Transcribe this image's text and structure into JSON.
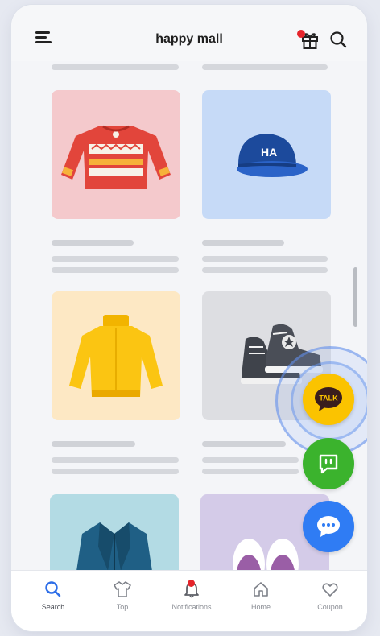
{
  "app": {
    "title": "happy mall"
  },
  "header": {
    "menu_icon": "hamburger-menu-icon",
    "gift_icon": "gift-icon",
    "search_icon": "search-icon"
  },
  "products": [
    {
      "name": "red-sweater",
      "icon": "sweater-icon",
      "background": "#f4c9cc"
    },
    {
      "name": "blue-cap",
      "icon": "cap-icon",
      "background": "#c6daf7"
    },
    {
      "name": "yellow-turtleneck",
      "icon": "turtleneck-icon",
      "background": "#fde8c4"
    },
    {
      "name": "high-top-sneakers",
      "icon": "sneakers-icon",
      "background": "#dddee2"
    },
    {
      "name": "navy-jacket",
      "icon": "jacket-icon",
      "background": "#b3dbe4"
    },
    {
      "name": "purple-sneakers",
      "icon": "sneakers-icon",
      "background": "#d4cbe8"
    }
  ],
  "cap_logo": "HA",
  "fabs": {
    "talk_label": "TALK",
    "talk_color": "#fbc300",
    "green_color": "#3bb32d",
    "blue_color": "#2f7cf4"
  },
  "tabbar": {
    "items": [
      {
        "label": "Search",
        "icon": "search-icon"
      },
      {
        "label": "Top",
        "icon": "shirt-icon"
      },
      {
        "label": "Notifications",
        "icon": "bell-icon"
      },
      {
        "label": "Home",
        "icon": "home-icon"
      },
      {
        "label": "Coupon",
        "icon": "heart-icon"
      }
    ],
    "active_index": 0,
    "accent": "#2f6fe8"
  }
}
